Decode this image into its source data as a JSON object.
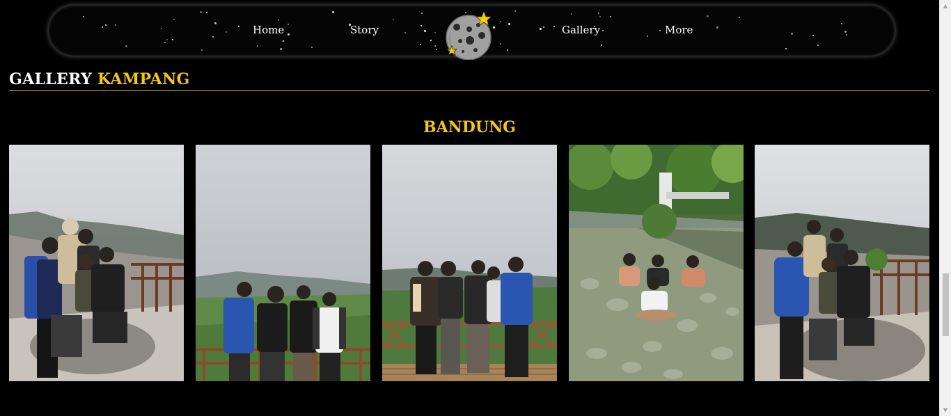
{
  "nav": {
    "items": [
      {
        "label": "Home"
      },
      {
        "label": "Story"
      },
      {
        "label": "Gallery"
      },
      {
        "label": "More"
      }
    ],
    "logo_icon": "moon-with-stars-icon"
  },
  "gallery": {
    "title_white": "GALLERY",
    "title_accent": "KAMPANG"
  },
  "section": {
    "title": "BANDUNG",
    "photos": [
      {
        "scene": "group-on-misty-crater-rock"
      },
      {
        "scene": "group-at-hilltop-railing"
      },
      {
        "scene": "group-on-wooden-deck"
      },
      {
        "scene": "group-in-river-stream"
      },
      {
        "scene": "group-on-crater-rock"
      }
    ]
  },
  "colors": {
    "background": "#000000",
    "accent": "#f5c518",
    "text": "#ffffff"
  }
}
